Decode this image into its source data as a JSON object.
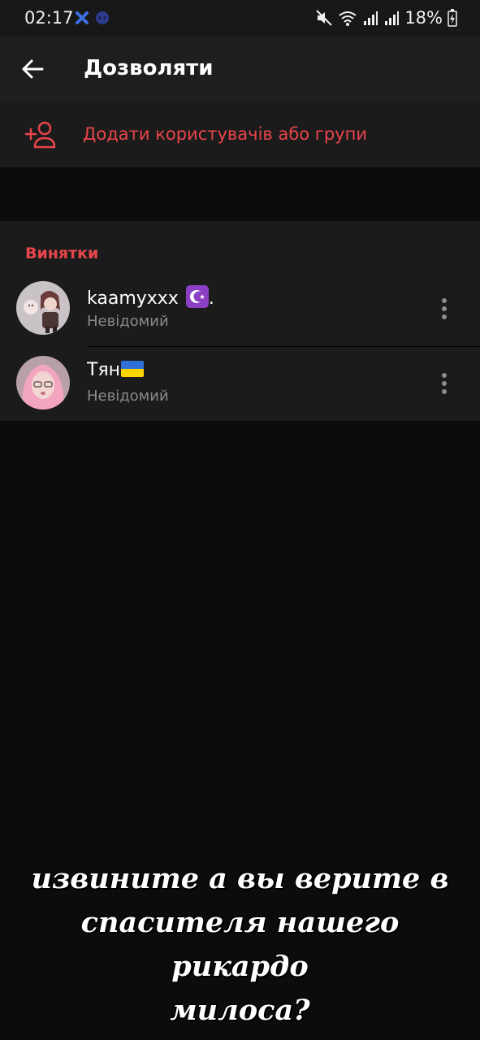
{
  "status_bar": {
    "time": "02:17",
    "battery_text": "18%",
    "icons": [
      "notification-app-icon",
      "discord-icon",
      "mute-icon",
      "wifi-icon",
      "signal-icon",
      "signal-icon",
      "battery-charging-icon"
    ]
  },
  "app_bar": {
    "title": "Дозволяти",
    "back_icon": "arrow-left-icon"
  },
  "add_row": {
    "label": "Додати користувачів або групи",
    "icon": "add-user-icon"
  },
  "exceptions": {
    "title": "Винятки",
    "items": [
      {
        "name": "kaamyxxx",
        "name_suffix": ".",
        "status": "Невідомий",
        "emoji": "star-and-crescent"
      },
      {
        "name": "Тян",
        "status": "Невідомий",
        "emoji": "ukraine-flag"
      }
    ]
  },
  "caption": {
    "line1": "извините а вы верите в",
    "line2": "спасителя нашего рикардо",
    "line3": "милоса?"
  },
  "colors": {
    "accent": "#e8454b",
    "background": "#0c0c0c",
    "surface": "#1b1b1b",
    "app_bar": "#1e1e1e",
    "secondary_text": "#8a8a8a"
  }
}
